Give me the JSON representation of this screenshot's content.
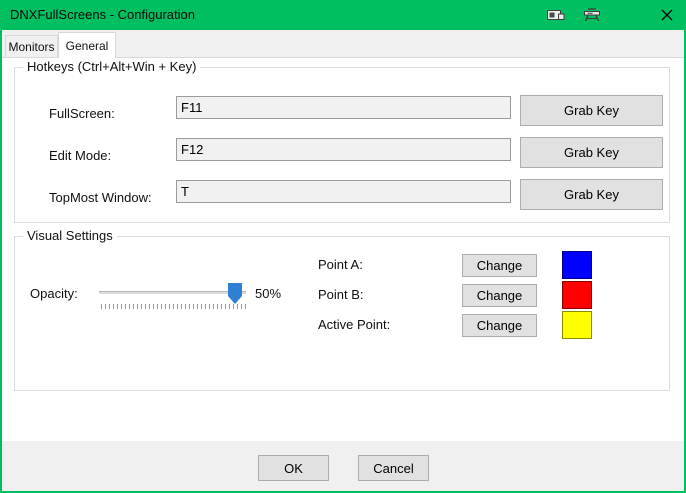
{
  "window": {
    "title": "DNXFullScreens - Configuration",
    "titlebar_color": "#00BF60"
  },
  "titlebar_icons": [
    "device-icon",
    "bench-icon",
    "close-icon"
  ],
  "tabs": [
    {
      "label": "Monitors",
      "active": false
    },
    {
      "label": "General",
      "active": true
    }
  ],
  "hotkeys": {
    "title": "Hotkeys (Ctrl+Alt+Win + Key)",
    "rows": [
      {
        "label": "FullScreen:",
        "value": "F11",
        "button": "Grab Key"
      },
      {
        "label": "Edit Mode:",
        "value": "F12",
        "button": "Grab Key"
      },
      {
        "label": "TopMost Window:",
        "value": "T",
        "button": "Grab Key"
      }
    ]
  },
  "visual": {
    "title": "Visual Settings",
    "opacity_label": "Opacity:",
    "opacity_value": "50%",
    "slider_thumb_color": "#2E80D3",
    "points": [
      {
        "label": "Point A:",
        "button": "Change",
        "color": "#0000FF"
      },
      {
        "label": "Point B:",
        "button": "Change",
        "color": "#FF0000"
      },
      {
        "label": "Active Point:",
        "button": "Change",
        "color": "#FFFF00"
      }
    ]
  },
  "footer": {
    "ok": "OK",
    "cancel": "Cancel"
  }
}
